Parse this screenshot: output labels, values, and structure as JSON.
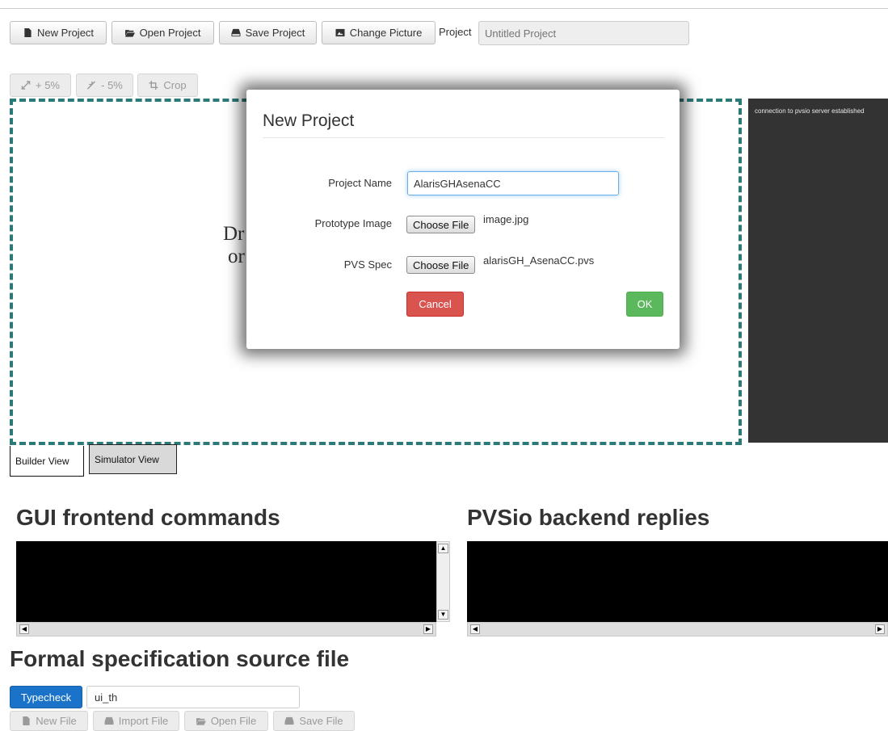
{
  "toolbar": {
    "new_project": "New Project",
    "open_project": "Open Project",
    "save_project": "Save Project",
    "change_picture": "Change Picture",
    "project_label": "Project",
    "project_placeholder": "Untitled Project"
  },
  "zoom": {
    "zoom_in": "+ 5%",
    "zoom_out": "- 5%",
    "crop": "Crop"
  },
  "canvas": {
    "drop_text_line1": "Dr",
    "drop_text_line2": "or"
  },
  "console": {
    "message": "connection to pvsio server established"
  },
  "views": {
    "builder": "Builder View",
    "simulator": "Simulator View"
  },
  "sections": {
    "gui_commands": "GUI frontend commands",
    "pvsio_replies": "PVSio backend replies",
    "formal_spec": "Formal specification source file"
  },
  "spec": {
    "typecheck": "Typecheck",
    "file_value": "ui_th",
    "new_file": "New File",
    "import_file": "Import File",
    "open_file": "Open File",
    "save_file": "Save File"
  },
  "modal": {
    "title": "New Project",
    "project_name_label": "Project Name",
    "project_name_value": "AlarisGHAsenaCC",
    "prototype_image_label": "Prototype Image",
    "choose_file": "Choose File",
    "prototype_image_file": "image.jpg",
    "pvs_spec_label": "PVS Spec",
    "pvs_spec_file": "alarisGH_AsenaCC.pvs",
    "cancel": "Cancel",
    "ok": "OK"
  },
  "colors": {
    "canvas_border": "#2b7a78",
    "console_bg": "#333333",
    "typecheck": "#1a73c8",
    "cancel": "#d9534f",
    "ok": "#5cb85c"
  }
}
